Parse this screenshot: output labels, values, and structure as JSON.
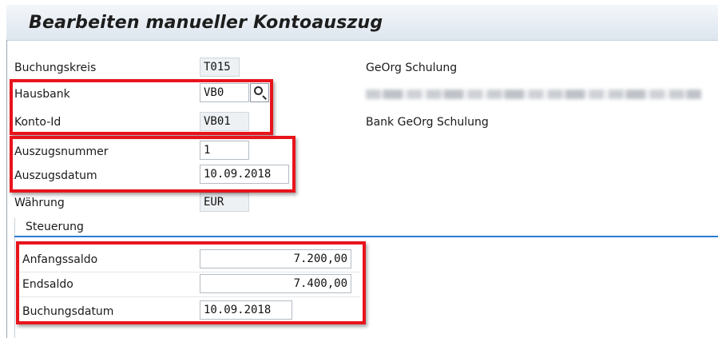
{
  "screen": {
    "title": "Bearbeiten manueller Kontoauszug"
  },
  "header_fields": [
    {
      "key": "buchungskreis",
      "label": "Buchungskreis",
      "value": "T015",
      "info": "GeOrg Schulung"
    },
    {
      "key": "hausbank",
      "label": "Hausbank",
      "value": "VB0"
    },
    {
      "key": "konto_id",
      "label": "Konto-Id",
      "value": "VB01",
      "info": "Bank GeOrg Schulung"
    },
    {
      "key": "auszugsnummer",
      "label": "Auszugsnummer",
      "value": "1"
    },
    {
      "key": "auszugsdatum",
      "label": "Auszugsdatum",
      "value": "10.09.2018"
    },
    {
      "key": "waehrung",
      "label": "Währung",
      "value": "EUR"
    }
  ],
  "steuerung": {
    "section_label": "Steuerung",
    "fields": [
      {
        "key": "anfangssaldo",
        "label": "Anfangssaldo",
        "value": "7.200,00"
      },
      {
        "key": "endsaldo",
        "label": "Endsaldo",
        "value": "7.400,00"
      },
      {
        "key": "buchungsdatum",
        "label": "Buchungsdatum",
        "value": "10.09.2018"
      }
    ]
  },
  "icons": {
    "hausbank_f4": "search-icon"
  },
  "colors": {
    "highlight": "#e8141c",
    "section_line": "#2a7bd1"
  }
}
